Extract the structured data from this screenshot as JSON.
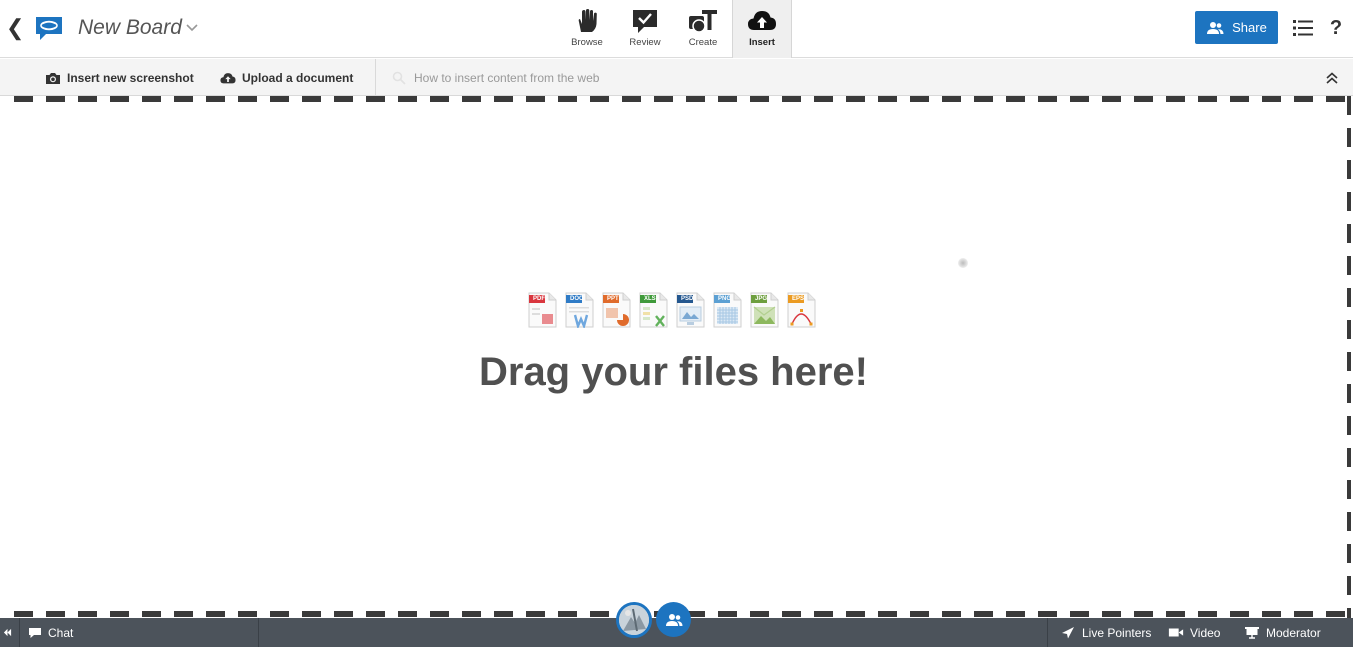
{
  "header": {
    "board_title": "New Board",
    "modes": [
      {
        "label": "Browse"
      },
      {
        "label": "Review"
      },
      {
        "label": "Create"
      },
      {
        "label": "Insert"
      }
    ],
    "share_label": "Share",
    "help_label": "?"
  },
  "subbar": {
    "screenshot_label": "Insert new screenshot",
    "upload_label": "Upload a document",
    "web_help_label": "How to insert content from the web"
  },
  "dropzone": {
    "message": "Drag your files here!",
    "file_types": [
      {
        "tag": "PDF",
        "color": "#d9363e"
      },
      {
        "tag": "DOC",
        "color": "#2f7bc6"
      },
      {
        "tag": "PPT",
        "color": "#e06b2c"
      },
      {
        "tag": "XLS",
        "color": "#3f9a3a"
      },
      {
        "tag": "PSD",
        "color": "#24578f"
      },
      {
        "tag": "PNG",
        "color": "#5ca0d3"
      },
      {
        "tag": "JPG",
        "color": "#6e9f3f"
      },
      {
        "tag": "EPS",
        "color": "#eb9b22"
      }
    ]
  },
  "footer": {
    "chat_label": "Chat",
    "live_pointers_label": "Live Pointers",
    "video_label": "Video",
    "moderator_label": "Moderator"
  },
  "colors": {
    "accent": "#1d74c0",
    "footer_bg": "#4c535b"
  }
}
